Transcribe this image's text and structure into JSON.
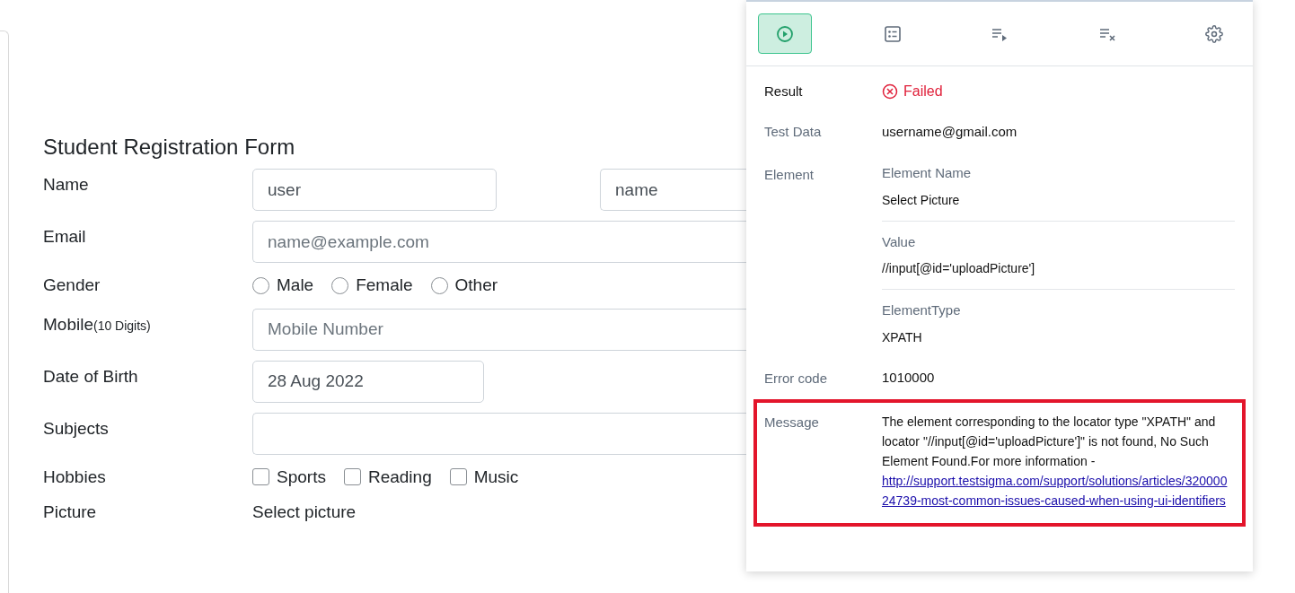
{
  "form": {
    "title": "Student Registration Form",
    "fields": [
      {
        "kind": "pair",
        "label": "Name",
        "inputs": [
          {
            "value": "user"
          },
          {
            "value": "name"
          }
        ]
      },
      {
        "kind": "text",
        "label": "Email",
        "placeholder": "name@example.com"
      },
      {
        "kind": "radio",
        "label": "Gender",
        "options": [
          {
            "label": "Male",
            "selected": false
          },
          {
            "label": "Female",
            "selected": false
          },
          {
            "label": "Other",
            "selected": false
          }
        ]
      },
      {
        "kind": "text",
        "label": "Mobile",
        "label_note": "(10 Digits)",
        "placeholder": "Mobile Number"
      },
      {
        "kind": "date",
        "label": "Date of Birth",
        "value": "28 Aug 2022"
      },
      {
        "kind": "text",
        "label": "Subjects"
      },
      {
        "kind": "checkbox",
        "label": "Hobbies",
        "options": [
          {
            "label": "Sports",
            "checked": false
          },
          {
            "label": "Reading",
            "checked": false
          },
          {
            "label": "Music",
            "checked": false
          }
        ]
      },
      {
        "kind": "file",
        "label": "Picture",
        "value": "Select picture"
      }
    ]
  },
  "panel": {
    "tabs": [
      {
        "selected": true
      },
      {
        "selected": false
      },
      {
        "selected": false
      },
      {
        "selected": false
      },
      {
        "selected": false
      }
    ],
    "rows": [
      {
        "kind": "status",
        "label": "Result",
        "value": "Failed"
      },
      {
        "kind": "text",
        "label": "Test Data",
        "value": "username@gmail.com"
      },
      {
        "kind": "group",
        "label": "Element",
        "items": [
          {
            "label": "Element Name",
            "value": "Select Picture"
          },
          {
            "label": "Value",
            "value": "//input[@id='uploadPicture']"
          },
          {
            "label": "ElementType",
            "value": "XPATH"
          }
        ]
      },
      {
        "kind": "text",
        "label": "Error code",
        "value": "1010000"
      },
      {
        "kind": "message",
        "label": "Message",
        "highlighted": true,
        "value": "The element corresponding to the locator type \"XPATH\" and locator \"//input[@id='uploadPicture']\" is not found, No Such Element Found.For more information -",
        "link": "http://support.testsigma.com/support/solutions/articles/32000024739-most-common-issues-caused-when-using-ui-identifiers"
      }
    ]
  }
}
